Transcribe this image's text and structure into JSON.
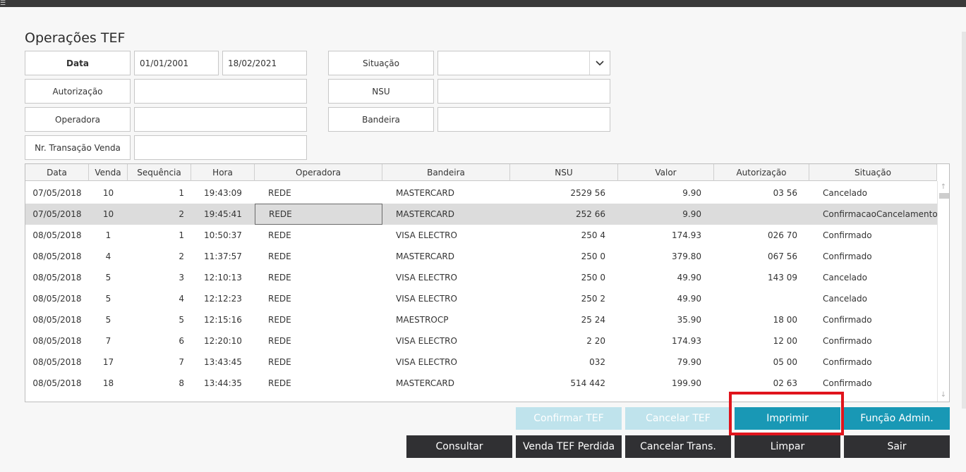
{
  "page_title": "Operações TEF",
  "filters": {
    "data_label": "Data",
    "date_from": "01/01/2001",
    "date_to": "18/02/2021",
    "autorizacao_label": "Autorização",
    "autorizacao_value": "",
    "operadora_label": "Operadora",
    "operadora_value": "",
    "nr_transacao_label": "Nr. Transação Venda",
    "nr_transacao_value": "",
    "situacao_label": "Situação",
    "situacao_value": "",
    "nsu_label": "NSU",
    "nsu_value": "",
    "bandeira_label": "Bandeira",
    "bandeira_value": ""
  },
  "grid": {
    "columns": [
      "Data",
      "Venda",
      "Sequência",
      "Hora",
      "Operadora",
      "Bandeira",
      "NSU",
      "Valor",
      "Autorização",
      "Situação"
    ],
    "rows": [
      {
        "data": "07/05/2018",
        "venda": "10",
        "sequencia": "1",
        "hora": "19:43:09",
        "operadora": "REDE",
        "bandeira": "MASTERCARD",
        "nsu": "2529 56",
        "valor": "9.90",
        "autorizacao": "03 56",
        "situacao": "Cancelado"
      },
      {
        "data": "07/05/2018",
        "venda": "10",
        "sequencia": "2",
        "hora": "19:45:41",
        "operadora": "REDE",
        "bandeira": "MASTERCARD",
        "nsu": "252 66",
        "valor": "9.90",
        "autorizacao": "",
        "situacao": "ConfirmacaoCancelamento"
      },
      {
        "data": "08/05/2018",
        "venda": "1",
        "sequencia": "1",
        "hora": "10:50:37",
        "operadora": "REDE",
        "bandeira": "VISA ELECTRO",
        "nsu": "250 4",
        "valor": "174.93",
        "autorizacao": "026 70",
        "situacao": "Confirmado"
      },
      {
        "data": "08/05/2018",
        "venda": "4",
        "sequencia": "2",
        "hora": "11:37:57",
        "operadora": "REDE",
        "bandeira": "MASTERCARD",
        "nsu": "250 0",
        "valor": "379.80",
        "autorizacao": "067 56",
        "situacao": "Confirmado"
      },
      {
        "data": "08/05/2018",
        "venda": "5",
        "sequencia": "3",
        "hora": "12:10:13",
        "operadora": "REDE",
        "bandeira": "VISA ELECTRO",
        "nsu": "250 0",
        "valor": "49.90",
        "autorizacao": "143 09",
        "situacao": "Cancelado"
      },
      {
        "data": "08/05/2018",
        "venda": "5",
        "sequencia": "4",
        "hora": "12:12:23",
        "operadora": "REDE",
        "bandeira": "VISA ELECTRO",
        "nsu": "250 2",
        "valor": "49.90",
        "autorizacao": "",
        "situacao": "Cancelado"
      },
      {
        "data": "08/05/2018",
        "venda": "5",
        "sequencia": "5",
        "hora": "12:15:16",
        "operadora": "REDE",
        "bandeira": "MAESTROCP",
        "nsu": "25 24",
        "valor": "35.90",
        "autorizacao": "18 00",
        "situacao": "Confirmado"
      },
      {
        "data": "08/05/2018",
        "venda": "7",
        "sequencia": "6",
        "hora": "12:20:10",
        "operadora": "REDE",
        "bandeira": "VISA ELECTRO",
        "nsu": "2 20",
        "valor": "174.93",
        "autorizacao": "12 00",
        "situacao": "Confirmado"
      },
      {
        "data": "08/05/2018",
        "venda": "17",
        "sequencia": "7",
        "hora": "13:43:45",
        "operadora": "REDE",
        "bandeira": "VISA ELECTRO",
        "nsu": "032",
        "valor": "79.90",
        "autorizacao": "05 00",
        "situacao": "Confirmado"
      },
      {
        "data": "08/05/2018",
        "venda": "18",
        "sequencia": "8",
        "hora": "13:44:35",
        "operadora": "REDE",
        "bandeira": "MASTERCARD",
        "nsu": "514 442",
        "valor": "199.90",
        "autorizacao": "02 63",
        "situacao": "Confirmado"
      }
    ]
  },
  "buttons": {
    "confirmar_tef": "Confirmar TEF",
    "cancelar_tef": "Cancelar TEF",
    "imprimir": "Imprimir",
    "funcao_admin": "Função Admin.",
    "consultar": "Consultar",
    "venda_tef_perdida": "Venda TEF Perdida",
    "cancelar_trans": "Cancelar Trans.",
    "limpar": "Limpar",
    "sair": "Sair"
  },
  "colors": {
    "accent": "#1998b5",
    "accent_disabled": "#bfe3ec",
    "dark_button": "#303033",
    "highlight_box": "#e0141c",
    "selected_row": "#dcdcdc"
  },
  "icons": {
    "dropdown": "chevron-down-icon",
    "scroll_up": "arrow-up-icon",
    "scroll_down": "arrow-down-icon"
  }
}
